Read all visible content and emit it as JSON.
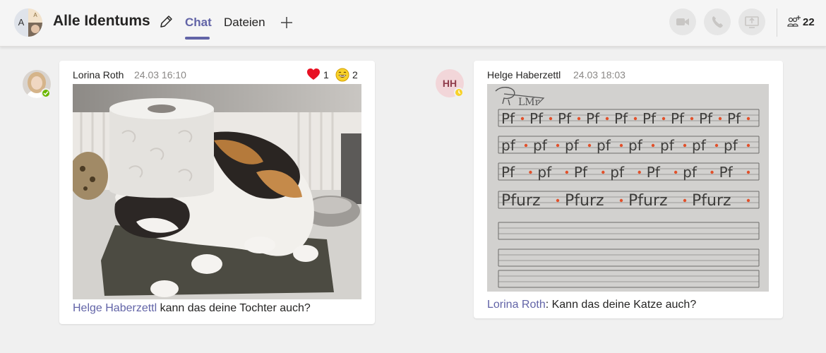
{
  "header": {
    "group_initial_left": "A",
    "group_initial_right": "A",
    "title": "Alle Identums",
    "tabs": [
      {
        "label": "Chat",
        "active": true
      },
      {
        "label": "Dateien",
        "active": false
      }
    ],
    "add_tab_icon": "plus-icon",
    "actions": [
      "video-call-icon",
      "audio-call-icon",
      "screen-share-icon"
    ],
    "participants_count": "22"
  },
  "messages": [
    {
      "sender": "Lorina Roth",
      "time": "24.03 16:10",
      "status": "available",
      "reactions": [
        {
          "icon": "heart-icon",
          "count": "1"
        },
        {
          "icon": "laugh-icon",
          "count": "2"
        }
      ],
      "image": "photo of a tricolor cat with a toilet paper roll on its head",
      "mention": "Helge Haberzettl",
      "text": " kann das deine Tochter auch?"
    },
    {
      "sender": "Helge Haberzettl",
      "initials": "HH",
      "time": "24.03 18:03",
      "status": "away",
      "image": "handwriting practice sheet",
      "handwriting": {
        "row1": [
          "Pf",
          "Pf",
          "Pf",
          "Pf",
          "Pf",
          "Pf",
          "Pf",
          "Pf",
          "Pf"
        ],
        "row2": [
          "pf",
          "pf",
          "pf",
          "pf",
          "pf",
          "pf",
          "pf",
          "pf"
        ],
        "row3": [
          "Pf",
          "pf",
          "Pf",
          "pf",
          "Pf",
          "pf",
          "Pf"
        ],
        "row4": [
          "Pfurz",
          "Pfurz",
          "Pfurz",
          "Pfurz"
        ]
      },
      "mention": "Lorina Roth",
      "text": ": Kann das deine Katze auch?"
    }
  ],
  "colors": {
    "accent": "#6264a7",
    "available": "#6bb700",
    "away": "#f8d22a",
    "heart": "#e81123"
  }
}
